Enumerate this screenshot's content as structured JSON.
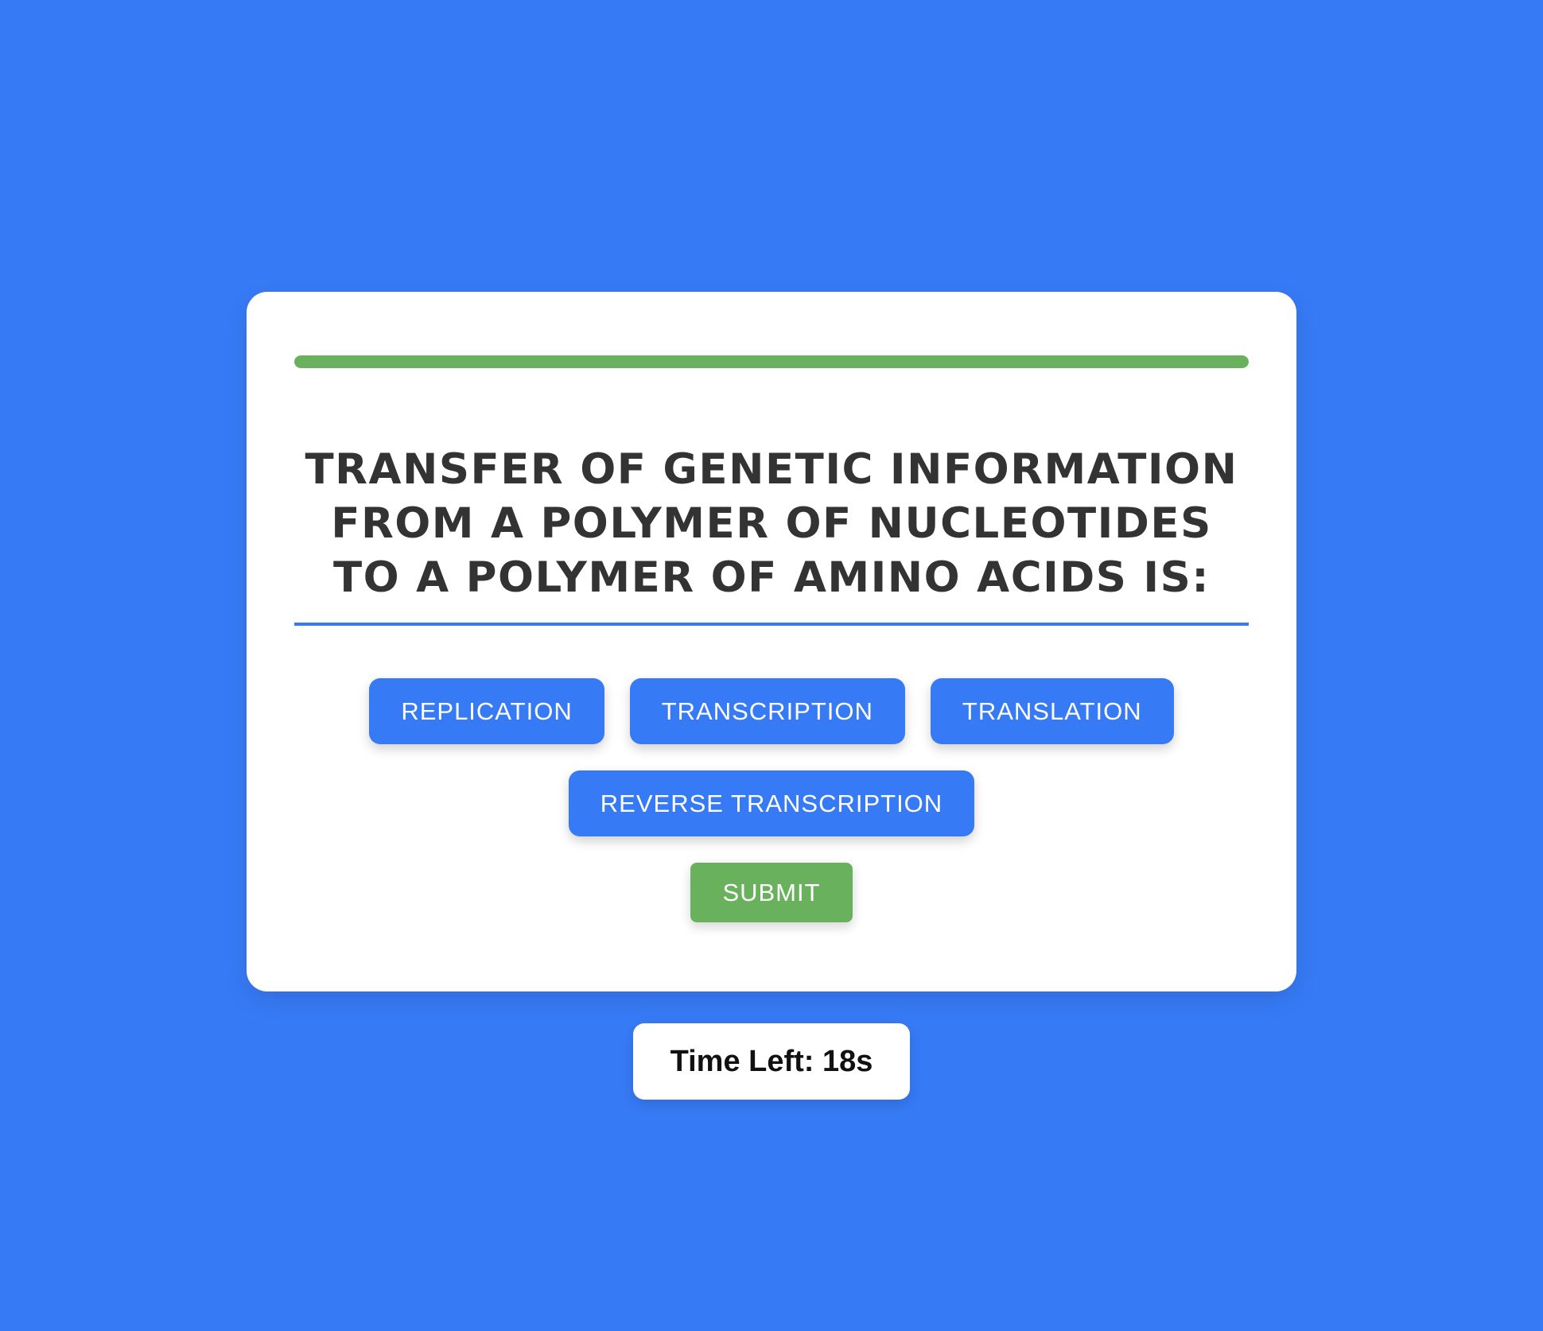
{
  "colors": {
    "background": "#377af5",
    "card": "#ffffff",
    "option_button": "#377af5",
    "submit_button": "#6ab15e",
    "progress_fill": "#6ab15e",
    "question_text": "#333333"
  },
  "progress": {
    "fraction": 1.0
  },
  "question": {
    "text": "Transfer of genetic information from a polymer of nucleotides to a polymer of amino acids is:"
  },
  "options": [
    {
      "label": "REPLICATION"
    },
    {
      "label": "TRANSCRIPTION"
    },
    {
      "label": "TRANSLATION"
    },
    {
      "label": "REVERSE TRANSCRIPTION"
    }
  ],
  "submit": {
    "label": "SUBMIT"
  },
  "timer": {
    "text": "Time Left: 18s"
  }
}
